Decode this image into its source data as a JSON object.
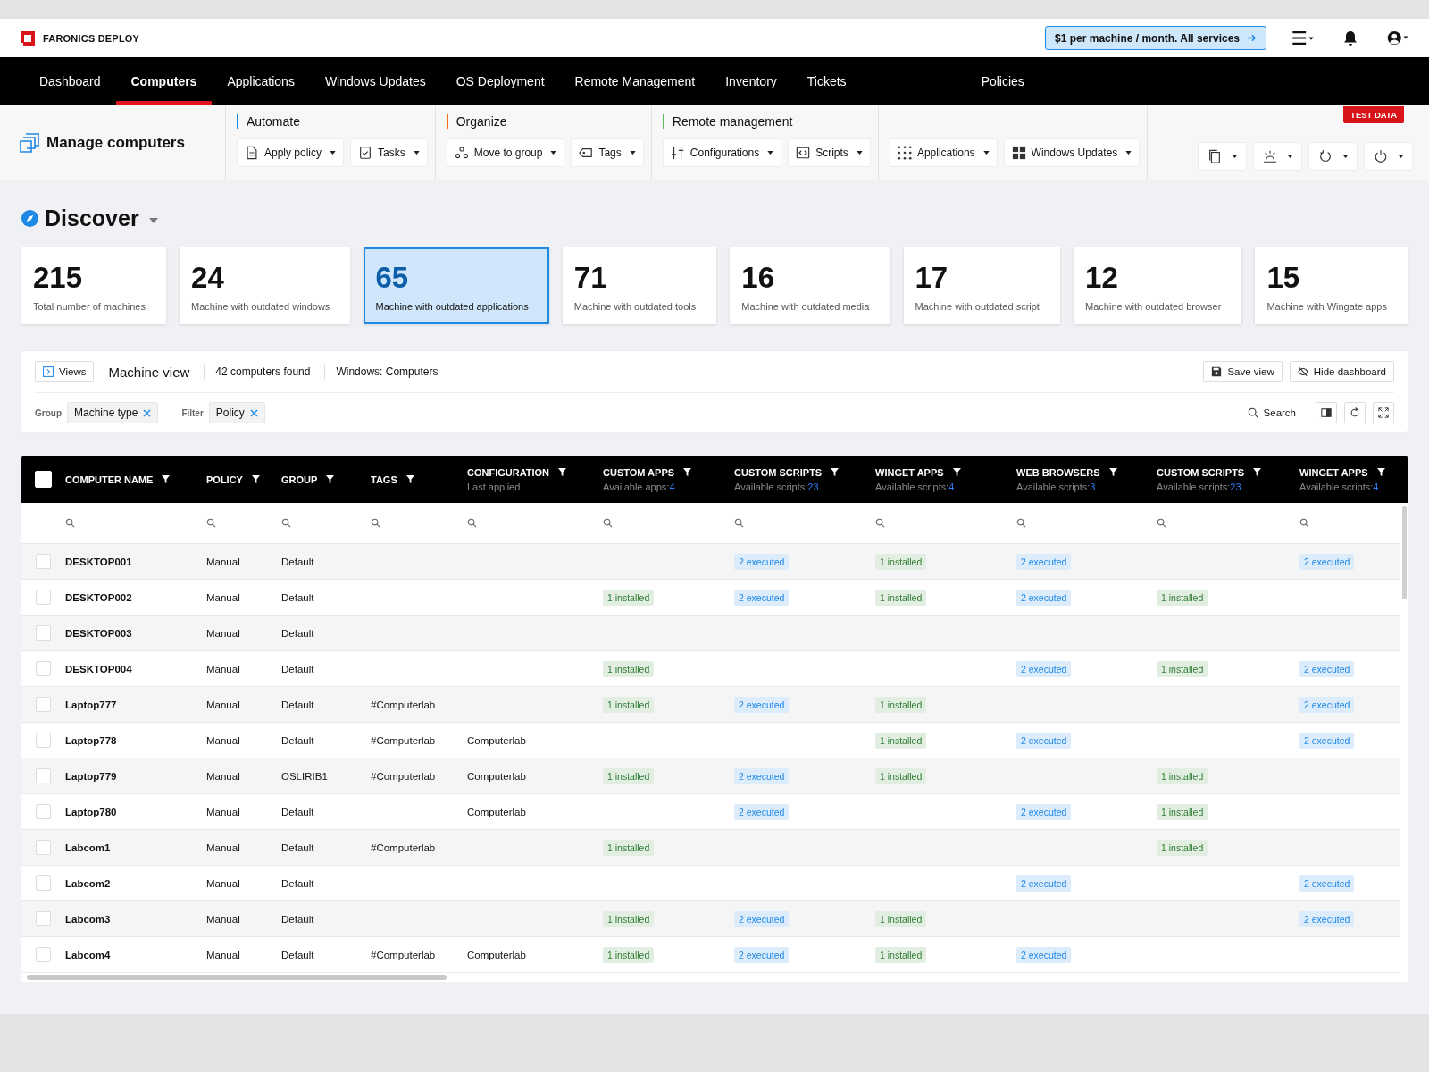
{
  "brand": {
    "name": "FARONICS DEPLOY"
  },
  "promo": {
    "label": "$1 per machine / month. All services"
  },
  "nav": [
    {
      "label": "Dashboard",
      "selected": false
    },
    {
      "label": "Computers",
      "selected": true
    },
    {
      "label": "Applications",
      "selected": false
    },
    {
      "label": "Windows Updates",
      "selected": false
    },
    {
      "label": "OS Deployment",
      "selected": false
    },
    {
      "label": "Remote Management",
      "selected": false
    },
    {
      "label": "Inventory",
      "selected": false
    },
    {
      "label": "Tickets",
      "selected": false
    },
    {
      "label": "Policies",
      "selected": false
    }
  ],
  "toolbar": {
    "title": "Manage computers",
    "badge": "TEST DATA",
    "groups": [
      {
        "label": "Automate",
        "color": "#1e88e5",
        "buttons": [
          "Apply policy",
          "Tasks"
        ]
      },
      {
        "label": "Organize",
        "color": "#f26b1d",
        "buttons": [
          "Move to group",
          "Tags"
        ]
      },
      {
        "label": "Remote management",
        "color": "#5cb85c",
        "buttons": [
          "Configurations",
          "Scripts"
        ]
      },
      {
        "buttons": [
          "Applications",
          "Windows Updates"
        ]
      }
    ]
  },
  "discover": {
    "title": "Discover"
  },
  "stats": [
    {
      "value": "215",
      "label": "Total number of machines",
      "selected": false
    },
    {
      "value": "24",
      "label": "Machine with outdated windows",
      "selected": false
    },
    {
      "value": "65",
      "label": "Machine with outdated applications",
      "selected": true
    },
    {
      "value": "71",
      "label": "Machine with outdated tools",
      "selected": false
    },
    {
      "value": "16",
      "label": "Machine with outdated media",
      "selected": false
    },
    {
      "value": "17",
      "label": "Machine with outdated script",
      "selected": false
    },
    {
      "value": "12",
      "label": "Machine with outdated browser",
      "selected": false
    },
    {
      "value": "15",
      "label": "Machine with Wingate apps",
      "selected": false
    }
  ],
  "view_panel": {
    "views_button": "Views",
    "title": "Machine view",
    "count": "42 computers found",
    "context": "Windows: Computers",
    "save": "Save view",
    "hide": "Hide dashboard",
    "group_label": "Group",
    "group_chip": "Machine type",
    "filter_label": "Filter",
    "filter_chip": "Policy",
    "search": "Search"
  },
  "table": {
    "all_selected": false,
    "columns": [
      {
        "label": "COMPUTER NAME"
      },
      {
        "label": "POLICY"
      },
      {
        "label": "GROUP"
      },
      {
        "label": "TAGS"
      },
      {
        "label": "CONFIGURATION",
        "sublabel": "Last applied"
      },
      {
        "label": "CUSTOM APPS",
        "sublabel": "Available apps:",
        "count": "4",
        "kind": "installed"
      },
      {
        "label": "CUSTOM SCRIPTS",
        "sublabel": "Available scripts:",
        "count": "23",
        "kind": "executed"
      },
      {
        "label": "WINGET APPS",
        "sublabel": "Available scripts:",
        "count": "4",
        "kind": "installed"
      },
      {
        "label": "WEB BROWSERS",
        "sublabel": "Available scripts:",
        "count": "3",
        "kind": "executed"
      },
      {
        "label": "CUSTOM SCRIPTS",
        "sublabel": "Available scripts:",
        "count": "23",
        "kind": "installed"
      },
      {
        "label": "WINGET APPS",
        "sublabel": "Available scripts:",
        "count": "4",
        "kind": "executed"
      }
    ],
    "rows": [
      {
        "selected": false,
        "name": "DESKTOP001",
        "policy": "Manual",
        "group": "Default",
        "custom_scripts": "2 executed",
        "winget_apps": "1 installed",
        "web_browsers": "2 executed",
        "winget_apps_2": "2 executed"
      },
      {
        "selected": false,
        "name": "DESKTOP002",
        "policy": "Manual",
        "group": "Default",
        "custom_apps": "1 installed",
        "custom_scripts": "2 executed",
        "winget_apps": "1 installed",
        "web_browsers": "2 executed",
        "custom_scripts_2": "1 installed"
      },
      {
        "selected": false,
        "name": "DESKTOP003",
        "policy": "Manual",
        "group": "Default"
      },
      {
        "selected": false,
        "name": "DESKTOP004",
        "policy": "Manual",
        "group": "Default",
        "custom_apps": "1 installed",
        "web_browsers": "2 executed",
        "custom_scripts_2": "1 installed",
        "winget_apps_2": "2 executed"
      },
      {
        "selected": false,
        "name": "Laptop777",
        "policy": "Manual",
        "group": "Default",
        "tags": "#Computerlab",
        "custom_apps": "1 installed",
        "custom_scripts": "2 executed",
        "winget_apps": "1 installed",
        "winget_apps_2": "2 executed"
      },
      {
        "selected": false,
        "name": "Laptop778",
        "policy": "Manual",
        "group": "Default",
        "tags": "#Computerlab",
        "configuration": "Computerlab",
        "winget_apps": "1 installed",
        "web_browsers": "2 executed",
        "winget_apps_2": "2 executed"
      },
      {
        "selected": false,
        "name": "Laptop779",
        "policy": "Manual",
        "group": "OSLIRIB1",
        "tags": "#Computerlab",
        "configuration": "Computerlab",
        "custom_apps": "1 installed",
        "custom_scripts": "2 executed",
        "winget_apps": "1 installed",
        "custom_scripts_2": "1 installed"
      },
      {
        "selected": false,
        "name": "Laptop780",
        "policy": "Manual",
        "group": "Default",
        "configuration": "Computerlab",
        "custom_scripts": "2 executed",
        "web_browsers": "2 executed",
        "custom_scripts_2": "1 installed"
      },
      {
        "selected": false,
        "name": "Labcom1",
        "policy": "Manual",
        "group": "Default",
        "tags": "#Computerlab",
        "custom_apps": "1 installed",
        "custom_scripts_2": "1 installed"
      },
      {
        "selected": false,
        "name": "Labcom2",
        "policy": "Manual",
        "group": "Default",
        "web_browsers": "2 executed",
        "winget_apps_2": "2 executed"
      },
      {
        "selected": false,
        "name": "Labcom3",
        "policy": "Manual",
        "group": "Default",
        "custom_apps": "1 installed",
        "custom_scripts": "2 executed",
        "winget_apps": "1 installed",
        "winget_apps_2": "2 executed"
      },
      {
        "selected": false,
        "name": "Labcom4",
        "policy": "Manual",
        "group": "Default",
        "tags": "#Computerlab",
        "configuration": "Computerlab",
        "custom_apps": "1 installed",
        "custom_scripts": "2 executed",
        "winget_apps": "1 installed",
        "web_browsers": "2 executed"
      }
    ]
  }
}
